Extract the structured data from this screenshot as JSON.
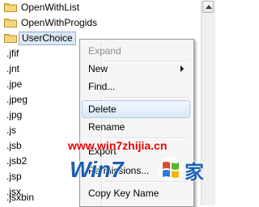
{
  "tree": {
    "items": [
      {
        "label": "OpenWithList",
        "type": "folder"
      },
      {
        "label": "OpenWithProgids",
        "type": "folder"
      },
      {
        "label": "UserChoice",
        "type": "folder",
        "selected": true
      },
      {
        "label": ".jfif"
      },
      {
        "label": ".jnt"
      },
      {
        "label": ".jpe"
      },
      {
        "label": ".jpeg"
      },
      {
        "label": ".jpg"
      },
      {
        "label": ".js"
      },
      {
        "label": ".jsb"
      },
      {
        "label": ".jsb2"
      },
      {
        "label": ".jsp"
      },
      {
        "label": ".jsx"
      },
      {
        "label": ".jsxbin"
      }
    ]
  },
  "context_menu": {
    "items": [
      {
        "label": "Expand",
        "disabled": true
      },
      {
        "label": "New",
        "has_submenu": true
      },
      {
        "label": "Find..."
      },
      {
        "label": "Delete",
        "hover": true
      },
      {
        "label": "Rename"
      },
      {
        "label": "Export"
      },
      {
        "label": "Permissions..."
      },
      {
        "label": "Copy Key Name"
      }
    ]
  },
  "watermark": {
    "url_text": "www.win7zhijia.cn",
    "logo_text": "Win7",
    "logo_suffix": "家"
  },
  "colors": {
    "folder": "#e8c45a",
    "selection": "#dde8f6",
    "watermark_red": "#e60000",
    "logo_blue": "#1a5fb4"
  }
}
